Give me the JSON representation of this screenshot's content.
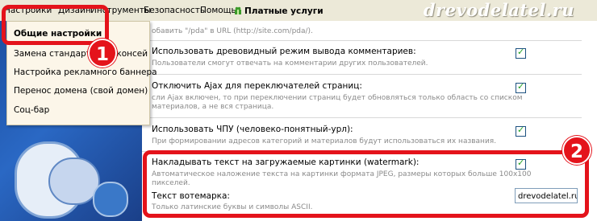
{
  "brand": "drevodelatel.ru",
  "menu": {
    "items": [
      "Настройки",
      "Дизайн",
      "Инструменты",
      "Безопасность",
      "Помощь"
    ],
    "paid_services": "Платные услуги"
  },
  "dropdown": {
    "items": [
      "Общие настройки",
      "Замена стандартных иконсей",
      "Настройка рекламного баннера",
      "Перенос домена (свой домен)",
      "Соц-бар"
    ]
  },
  "settings": {
    "pda_hint": "обавить \"/pda\" в URL (http://site.com/pda/).",
    "tree_label": "Использовать древовидный режим вывода комментариев:",
    "tree_hint": "Пользователи смогут отвечать на комментарии других пользователей.",
    "ajax_label": "Отключить Ajax для переключателей страниц:",
    "ajax_hint_1": "сли Ajax включен, то при переключении страниц будет обновляться только область со списком",
    "ajax_hint_2": "материалов, а не вся страница.",
    "chpu_label": "Использовать ЧПУ (человеко-понятный-урл):",
    "chpu_hint": "При формировании адресов категорий и материалов будут использоваться их названия.",
    "watermark_label": "Накладывать текст на загружаемые картинки (watermark):",
    "watermark_hint_1": "Автоматическое наложение текста на картинки формата JPEG, размеры которых больше 100x100",
    "watermark_hint_2": "пикселей.",
    "watermark_text_label": "Текст вотемарка:",
    "watermark_text_hint": "Только латинские буквы и символы ASCII.",
    "watermark_text_value": "drevodelatel.ru"
  },
  "annotations": {
    "first": "1",
    "second": "2"
  },
  "colors": {
    "accent": "#e4131b",
    "menubar": "#ece9d8",
    "dropdown": "#fcf6e9"
  }
}
